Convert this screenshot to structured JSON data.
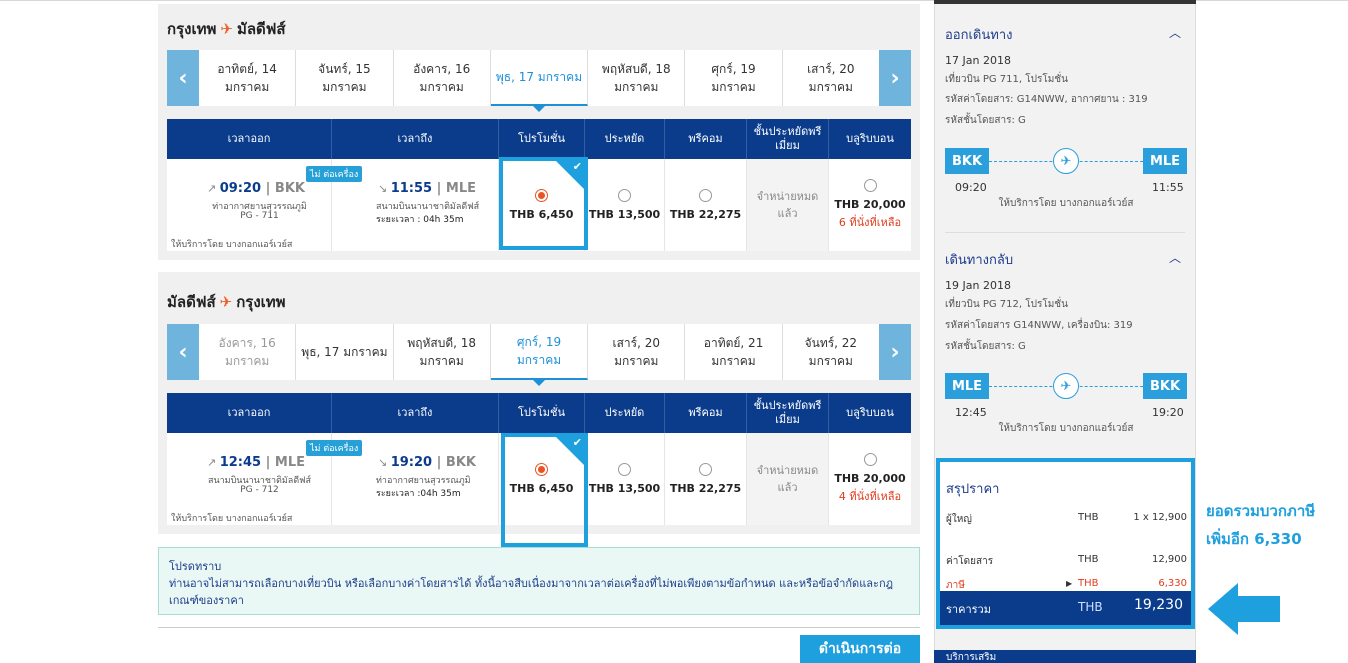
{
  "outbound": {
    "title_from": "กรุงเทพ",
    "title_to": "มัลดีฟส์",
    "dates": [
      {
        "day": "อาทิตย์, 14",
        "month": "มกราคม"
      },
      {
        "day": "จันทร์, 15",
        "month": "มกราคม"
      },
      {
        "day": "อังคาร, 16",
        "month": "มกราคม"
      },
      {
        "day": "พุธ, 17 มกราคม",
        "month": ""
      },
      {
        "day": "พฤหัสบดี, 18",
        "month": "มกราคม"
      },
      {
        "day": "ศุกร์, 19",
        "month": "มกราคม"
      },
      {
        "day": "เสาร์, 20",
        "month": "มกราคม"
      }
    ],
    "flight": {
      "badge": "ไม่ ต่อเครื่อง",
      "dep_time": "09:20",
      "dep_code": "BKK",
      "dep_airport": "ท่าอากาศยานสุวรรณภูมิ",
      "flight_no": "PG - 711",
      "arr_time": "11:55",
      "arr_code": "MLE",
      "arr_airport": "สนามบินนานาชาติมัลดีฟส์",
      "duration": "ระยะเวลา : 04h 35m",
      "operated": "ให้บริการโดย บางกอกแอร์เวย์ส",
      "fares": {
        "promo": "THB 6,450",
        "economy": "THB 13,500",
        "premium": "THB 22,275",
        "soldout": "จำหน่ายหมดแล้ว",
        "business": "THB 20,000",
        "business_left": "6 ที่นั่งที่เหลือ"
      }
    }
  },
  "inbound": {
    "title_from": "มัลดีฟส์",
    "title_to": "กรุงเทพ",
    "dates": [
      {
        "day": "อังคาร, 16",
        "month": "มกราคม"
      },
      {
        "day": "พุธ, 17 มกราคม",
        "month": ""
      },
      {
        "day": "พฤหัสบดี, 18",
        "month": "มกราคม"
      },
      {
        "day": "ศุกร์, 19",
        "month": "มกราคม"
      },
      {
        "day": "เสาร์, 20",
        "month": "มกราคม"
      },
      {
        "day": "อาทิตย์, 21",
        "month": "มกราคม"
      },
      {
        "day": "จันทร์, 22",
        "month": "มกราคม"
      }
    ],
    "flight": {
      "badge": "ไม่ ต่อเครื่อง",
      "dep_time": "12:45",
      "dep_code": "MLE",
      "dep_airport": "สนามบินนานาชาติมัลดีฟส์",
      "flight_no": "PG - 712",
      "arr_time": "19:20",
      "arr_code": "BKK",
      "arr_airport": "ท่าอากาศยานสุวรรณภูมิ",
      "duration": "ระยะเวลา :04h 35m",
      "operated": "ให้บริการโดย บางกอกแอร์เวย์ส",
      "fares": {
        "promo": "THB 6,450",
        "economy": "THB 13,500",
        "premium": "THB 22,275",
        "soldout": "จำหน่ายหมดแล้ว",
        "business": "THB 20,000",
        "business_left": "4 ที่นั่งที่เหลือ"
      }
    }
  },
  "table_headers": {
    "depart": "เวลาออก",
    "arrive": "เวลาถึง",
    "promo": "โปรโมชั่น",
    "economy": "ประหยัด",
    "premium": "พรีคอม",
    "premium_economy": "ชั้นประหยัดพรีเมี่ยม",
    "business": "บลูริบบอน"
  },
  "notice": {
    "title": "โปรดทราบ",
    "text": "ท่านอาจไม่สามารถเลือกบางเที่ยวบิน หรือเลือกบางค่าโดยสารได้ ทั้งนี้อาจสืบเนื่องมาจากเวลาต่อเครื่องที่ไม่พอเพียงตามข้อกำหนด และหรือข้อจำกัดและกฎเกณฑ์ของราคา"
  },
  "continue_label": "ดำเนินการต่อ",
  "sidebar": {
    "outbound": {
      "heading": "ออกเดินทาง",
      "date": "17 Jan 2018",
      "line1": "เที่ยวบิน PG 711, โปรโมชั่น",
      "line2": "รหัสค่าโดยสาร: G14NWW, อากาศยาน : 319",
      "line3": "รหัสชั้นโดยสาร: G",
      "from": "BKK",
      "to": "MLE",
      "dep_time": "09:20",
      "arr_time": "11:55",
      "operated": "ให้บริการโดย บางกอกแอร์เวย์ส"
    },
    "inbound": {
      "heading": "เดินทางกลับ",
      "date": "19 Jan 2018",
      "line1": "เที่ยวบิน PG 712, โปรโมชั่น",
      "line2": "รหัสค่าโดยสาร G14NWW, เครื่องบิน: 319",
      "line3": "รหัสชั้นโดยสาร: G",
      "from": "MLE",
      "to": "BKK",
      "dep_time": "12:45",
      "arr_time": "19:20",
      "operated": "ให้บริการโดย บางกอกแอร์เวย์ส"
    },
    "summary": {
      "title": "สรุปราคา",
      "adult_label": "ผู้ใหญ่",
      "adult_cur": "THB",
      "adult_val": "1 x 12,900",
      "fare_label": "ค่าโดยสาร",
      "fare_cur": "THB",
      "fare_val": "12,900",
      "tax_label": "ภาษี",
      "tax_cur": "THB",
      "tax_val": "6,330",
      "total_label": "ราคารวม",
      "total_cur": "THB",
      "total_val": "19,230"
    },
    "bottom_label": "บริการเสริม"
  },
  "callout": {
    "line1": "ยอดรวมบวกภาษี",
    "line2": "เพิ่มอีก 6,330"
  },
  "colors": {
    "navy": "#0b3c8c",
    "accent": "#1e9fde",
    "orange": "#e9602a"
  }
}
